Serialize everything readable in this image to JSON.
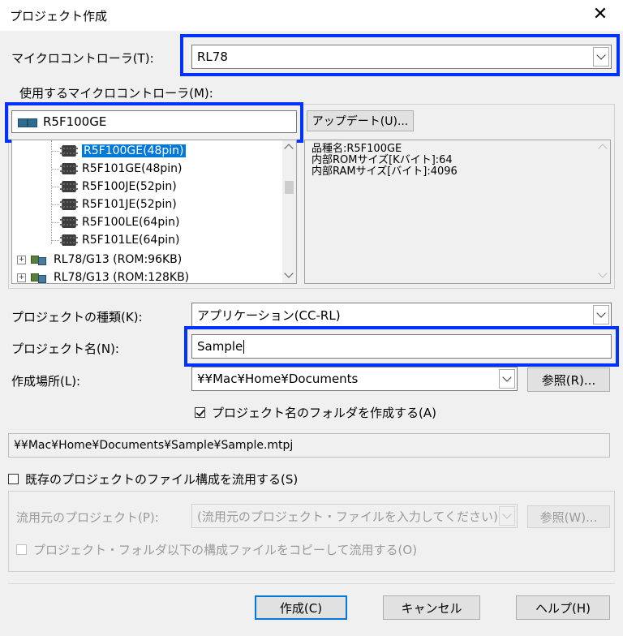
{
  "window": {
    "title": "プロジェクト作成",
    "close_glyph": "✕"
  },
  "mcu": {
    "label": "マイクロコントローラ(T):",
    "value": "RL78"
  },
  "use_mcu": {
    "label": "使用するマイクロコントローラ(M):",
    "search_value": "R5F100GE",
    "update_button": "アップデート(U)...",
    "tree": [
      {
        "text": "R5F100GE(48pin)",
        "selected": true
      },
      {
        "text": "R5F101GE(48pin)"
      },
      {
        "text": "R5F100JE(52pin)"
      },
      {
        "text": "R5F101JE(52pin)"
      },
      {
        "text": "R5F100LE(64pin)"
      },
      {
        "text": "R5F101LE(64pin)"
      }
    ],
    "groups": [
      {
        "text": "RL78/G13 (ROM:96KB)"
      },
      {
        "text": "RL78/G13 (ROM:128KB)"
      }
    ],
    "info": [
      "品種名:R5F100GE",
      "内部ROMサイズ[Kバイト]:64",
      "内部RAMサイズ[バイト]:4096"
    ]
  },
  "project_type": {
    "label": "プロジェクトの種類(K):",
    "value": "アプリケーション(CC-RL)"
  },
  "project_name": {
    "label": "プロジェクト名(N):",
    "value": "Sample"
  },
  "location": {
    "label": "作成場所(L):",
    "value": "¥¥Mac¥Home¥Documents",
    "browse": "参照(R)..."
  },
  "make_folder": {
    "label": "プロジェクト名のフォルダを作成する(A)",
    "checked": true
  },
  "path_preview": "¥¥Mac¥Home¥Documents¥Sample¥Sample.mtpj",
  "reuse": {
    "label": "既存のプロジェクトのファイル構成を流用する(S)",
    "checked": false
  },
  "source_project": {
    "label": "流用元のプロジェクト(P):",
    "placeholder": "(流用元のプロジェクト・ファイルを入力してください)",
    "browse": "参照(W)..."
  },
  "copy_files": {
    "label": "プロジェクト・フォルダ以下の構成ファイルをコピーして流用する(O)"
  },
  "buttons": {
    "create": "作成(C)",
    "cancel": "キャンセル",
    "help": "ヘルプ(H)"
  },
  "colors": {
    "highlight": "#0033ff",
    "selection": "#0078d7"
  }
}
